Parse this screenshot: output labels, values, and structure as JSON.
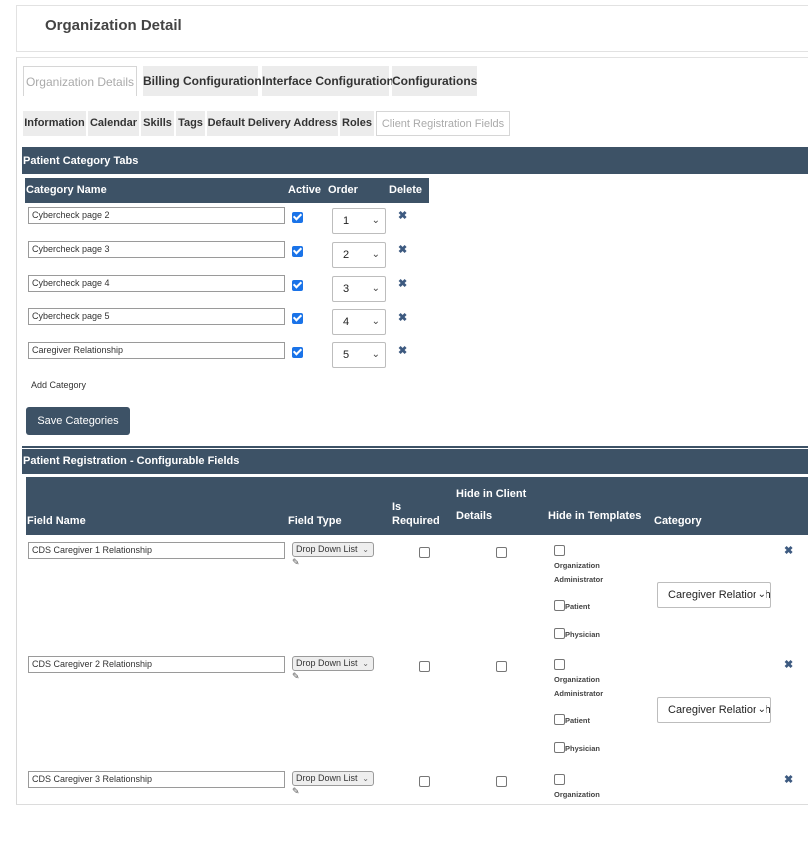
{
  "page_title": "Organization Detail",
  "main_tabs": [
    {
      "label": "Organization Details",
      "active": true
    },
    {
      "label": "Billing Configuration",
      "active": false
    },
    {
      "label": "Interface Configuration",
      "active": false
    },
    {
      "label": "Configurations",
      "active": false
    }
  ],
  "sub_tabs": [
    {
      "label": "Information",
      "active": false
    },
    {
      "label": "Calendar",
      "active": false
    },
    {
      "label": "Skills",
      "active": false
    },
    {
      "label": "Tags",
      "active": false
    },
    {
      "label": "Default Delivery Address",
      "active": false
    },
    {
      "label": "Roles",
      "active": false
    },
    {
      "label": "Client Registration Fields",
      "active": true
    }
  ],
  "patient_category": {
    "section_title": "Patient Category Tabs",
    "columns": {
      "name": "Category Name",
      "active": "Active",
      "order": "Order",
      "delete": "Delete"
    },
    "rows": [
      {
        "name": "Cybercheck page 2",
        "active": true,
        "order": "1"
      },
      {
        "name": "Cybercheck page 3",
        "active": true,
        "order": "2"
      },
      {
        "name": "Cybercheck page 4",
        "active": true,
        "order": "3"
      },
      {
        "name": "Cybercheck page 5",
        "active": true,
        "order": "4"
      },
      {
        "name": "Caregiver Relationship",
        "active": true,
        "order": "5"
      }
    ],
    "add_label": "Add Category",
    "save_label": "Save Categories"
  },
  "registration": {
    "section_title": "Patient Registration - Configurable Fields",
    "columns": {
      "field_name": "Field Name",
      "field_type": "Field Type",
      "is_required_line1": "Is",
      "is_required_line2": "Required",
      "hide_client_line1": "Hide in Client",
      "hide_client_line2": "Details",
      "hide_templates": "Hide in Templates",
      "category": "Category"
    },
    "template_labels": {
      "org_line1": "Organization",
      "org_line2": "Administrator",
      "patient": "Patient",
      "physician": "Physician"
    },
    "rows": [
      {
        "name": "CDS Caregiver 1 Relationship",
        "type": "Drop Down List",
        "category": "Caregiver Relationship"
      },
      {
        "name": "CDS Caregiver 2 Relationship",
        "type": "Drop Down List",
        "category": "Caregiver Relationship"
      },
      {
        "name": "CDS Caregiver 3 Relationship",
        "type": "Drop Down List",
        "category": ""
      }
    ]
  },
  "icons": {
    "delete": "close-x-icon",
    "edit": "pencil-edit-icon",
    "dropdown": "chevron-down-icon"
  },
  "colors": {
    "header_bg": "#3d5266",
    "checkbox_checked": "#1a73e8",
    "tab_bg": "#ececec"
  }
}
